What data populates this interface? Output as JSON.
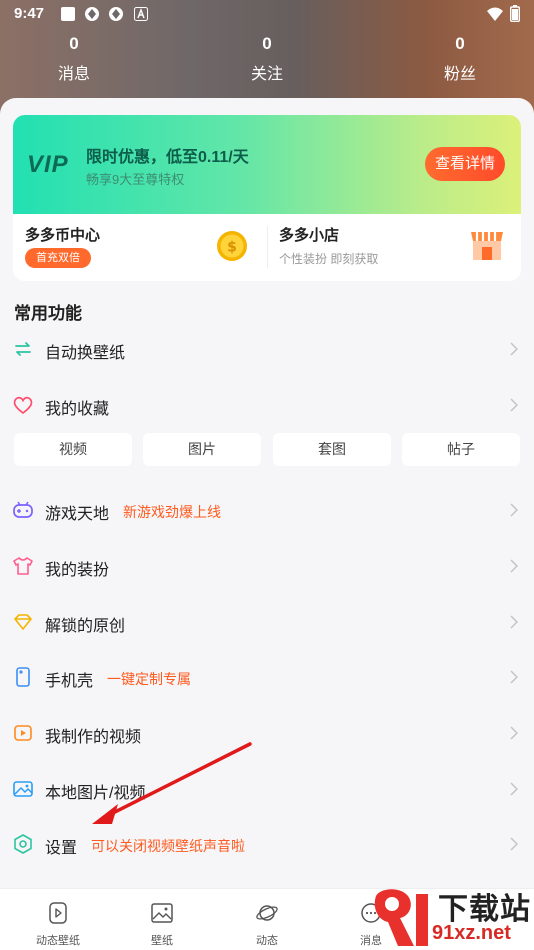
{
  "status_bar": {
    "time": "9:47",
    "notification_icons": [
      "square-icon",
      "aperture-icon",
      "aperture-icon",
      "a-badge-icon"
    ],
    "right_icons": [
      "wifi-icon",
      "battery-icon"
    ]
  },
  "stats": [
    {
      "count": "0",
      "label": "消息"
    },
    {
      "count": "0",
      "label": "关注"
    },
    {
      "count": "0",
      "label": "粉丝"
    }
  ],
  "vip": {
    "logo": "VIP",
    "title": "限时优惠，低至0.11/天",
    "subtitle": "畅享9大至尊特权",
    "button": "查看详情"
  },
  "coin_center": {
    "title": "多多币中心",
    "badge": "首充双倍"
  },
  "shop": {
    "title": "多多小店",
    "subtitle": "个性装扮 即刻获取"
  },
  "section_title": "常用功能",
  "menu": [
    {
      "label": "自动换壁纸",
      "tag": "",
      "icon": "refresh-icon"
    },
    {
      "label": "我的收藏",
      "tag": "",
      "icon": "heart-icon"
    },
    {
      "label": "游戏天地",
      "tag": "新游戏劲爆上线",
      "icon": "gamepad-icon"
    },
    {
      "label": "我的装扮",
      "tag": "",
      "icon": "tshirt-icon"
    },
    {
      "label": "解锁的原创",
      "tag": "",
      "icon": "diamond-icon"
    },
    {
      "label": "手机壳",
      "tag": "一键定制专属",
      "icon": "phone-icon"
    },
    {
      "label": "我制作的视频",
      "tag": "",
      "icon": "video-icon"
    },
    {
      "label": "本地图片/视频",
      "tag": "",
      "icon": "image-icon"
    },
    {
      "label": "设置",
      "tag": "可以关闭视频壁纸声音啦",
      "icon": "settings-icon"
    }
  ],
  "chips": [
    "视频",
    "图片",
    "套图",
    "帖子"
  ],
  "bottom_nav": [
    {
      "label": "动态壁纸",
      "icon": "play-icon"
    },
    {
      "label": "壁纸",
      "icon": "picture-icon"
    },
    {
      "label": "动态",
      "icon": "planet-icon"
    },
    {
      "label": "消息",
      "icon": "chat-icon"
    }
  ],
  "watermark": {
    "top": "下载站",
    "bottom": "91xz.net"
  },
  "colors": {
    "accent_orange": "#ff5a1f",
    "vip_green": "#22e0b2",
    "annotation_red": "#e0191b"
  }
}
